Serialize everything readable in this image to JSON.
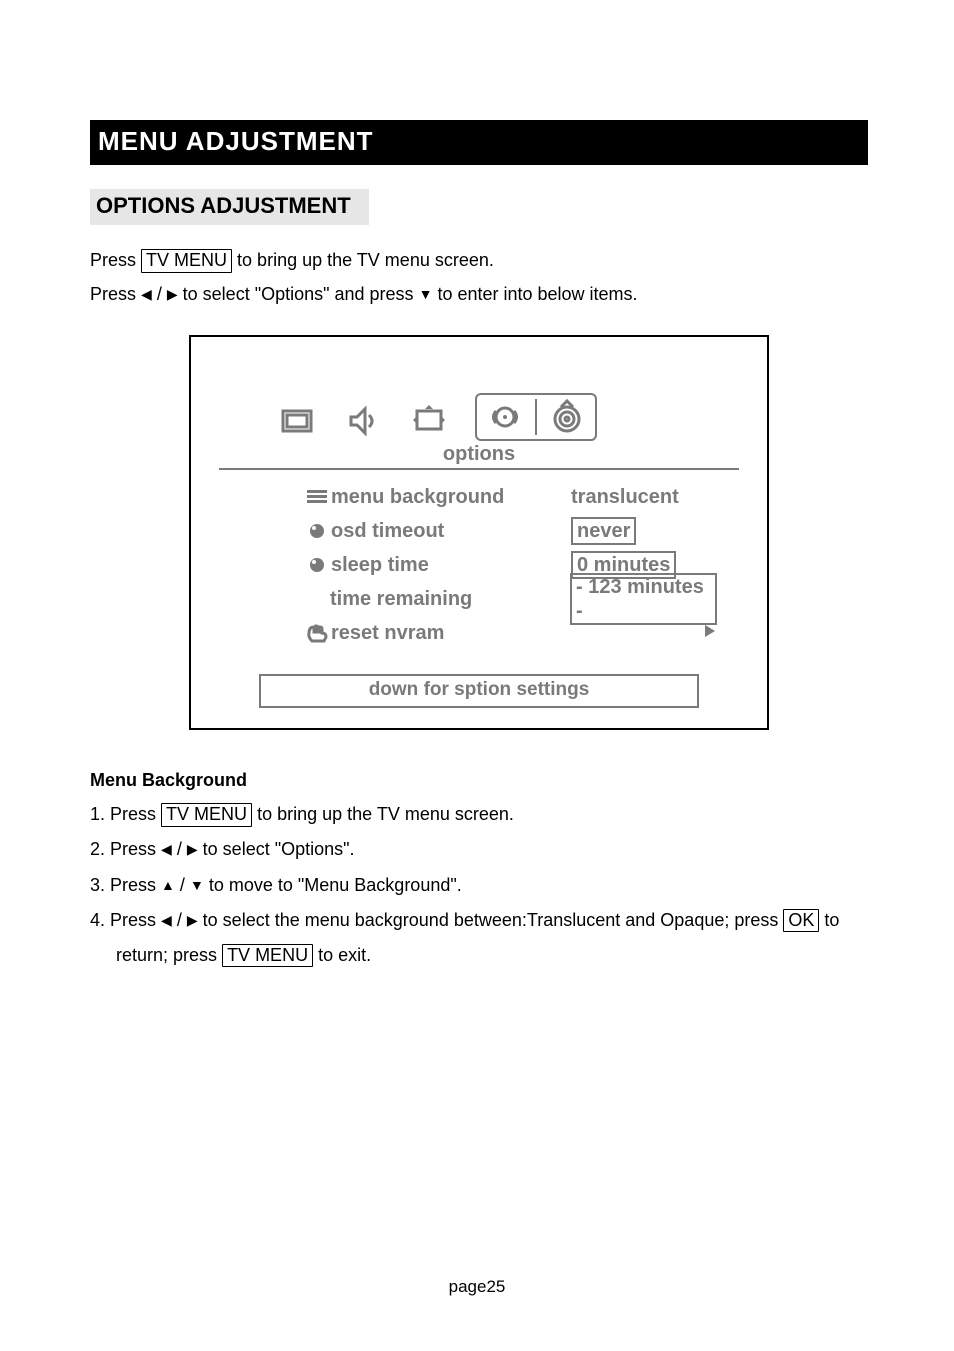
{
  "title": "MENU ADJUSTMENT",
  "section_title": "OPTIONS ADJUSTMENT",
  "intro": {
    "press": "Press",
    "tvmenu": "TV MENU",
    "line1_rest": "to bring up the TV menu screen.",
    "line2_a": "Press",
    "line2_slash": "/",
    "line2_b": "to select \"Options\" and press",
    "line2_c": "to enter into below items."
  },
  "osd": {
    "options_label": "options",
    "rows": [
      {
        "label": "menu background",
        "value": "translucent",
        "boxed": false
      },
      {
        "label": "osd timeout",
        "value": "never",
        "boxed": true
      },
      {
        "label": "sleep time",
        "value": "0 minutes",
        "boxed": true
      },
      {
        "label": "time remaining",
        "value": "- 123 minutes -",
        "boxed": true
      },
      {
        "label": "reset nvram",
        "value": "",
        "boxed": false
      }
    ],
    "down_label": "down for sption settings"
  },
  "subsection": "Menu Background",
  "steps": {
    "s1a": "1. Press",
    "s1b": "to bring up the TV menu screen.",
    "s2a": "2. Press",
    "s2b": "to select \"Options\".",
    "s3a": "3. Press",
    "s3b": "to move to \"Menu Background\".",
    "s4a": "4. Press",
    "s4b": "to select the menu background between:Translucent and Opaque; press",
    "s4c": "to",
    "s4d": "return; press",
    "s4e": "to exit.",
    "ok": "OK",
    "tvmenu": "TV MENU",
    "slash": "/"
  },
  "footer": "page25"
}
